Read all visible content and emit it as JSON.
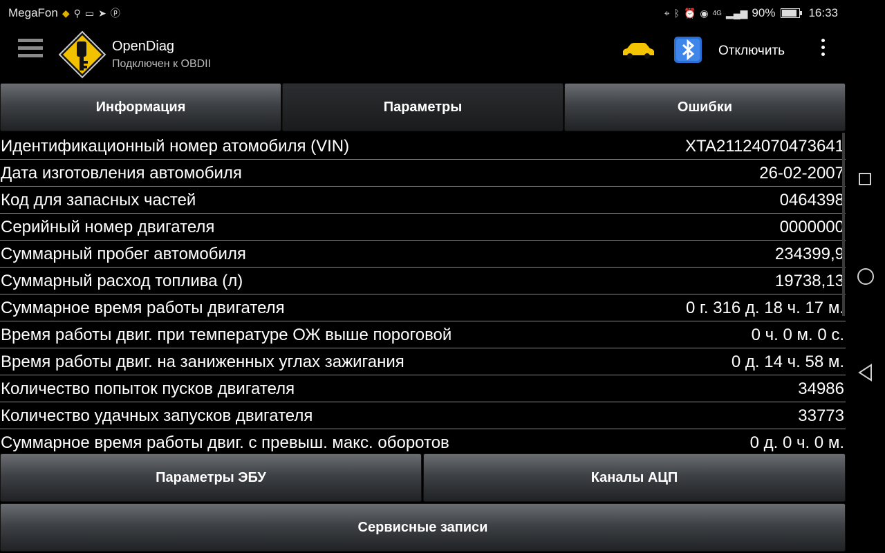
{
  "status_bar": {
    "carrier": "MegaFon",
    "network": "4G",
    "battery": "90%",
    "battery_level": 0.9,
    "time": "16:33"
  },
  "app_bar": {
    "title": "OpenDiag",
    "subtitle": "Подключен к OBDII",
    "disconnect_label": "Отключить"
  },
  "tabs": [
    {
      "label": "Информация",
      "active": false
    },
    {
      "label": "Параметры",
      "active": true
    },
    {
      "label": "Ошибки",
      "active": false
    }
  ],
  "rows": [
    {
      "label": "Идентификационный номер атомобиля (VIN)",
      "value": "XTA21124070473641"
    },
    {
      "label": "Дата изготовления автомобиля",
      "value": "26-02-2007"
    },
    {
      "label": "Код для запасных частей",
      "value": "0464398"
    },
    {
      "label": "Серийный номер двигателя",
      "value": "0000000"
    },
    {
      "label": "Суммарный пробег автомобиля",
      "value": "234399,9"
    },
    {
      "label": "Суммарный расход топлива (л)",
      "value": "19738,13"
    },
    {
      "label": "Суммарное время работы двигателя",
      "value": "0 г. 316 д. 18 ч. 17 м."
    },
    {
      "label": "Время работы двиг. при температуре ОЖ выше пороговой",
      "value": "0 ч. 0 м. 0 с."
    },
    {
      "label": "Время работы двиг. на заниженных углах зажигания",
      "value": "0 д. 14 ч. 58 м."
    },
    {
      "label": "Количество попыток пусков двигателя",
      "value": "34986"
    },
    {
      "label": "Количество удачных запусков двигателя",
      "value": "33773"
    },
    {
      "label": "Суммарное время работы двиг. с превыш. макс. оборотов",
      "value": "0 д. 0 ч. 0 м."
    }
  ],
  "buttons": {
    "ecu_params": "Параметры ЭБУ",
    "adc_channels": "Каналы АЦП",
    "service_records": "Сервисные записи"
  },
  "colors": {
    "background": "#000000",
    "logo_yellow": "#f2c200",
    "car_yellow": "#f5c400",
    "bluetooth_blue": "#2a6fd6"
  }
}
